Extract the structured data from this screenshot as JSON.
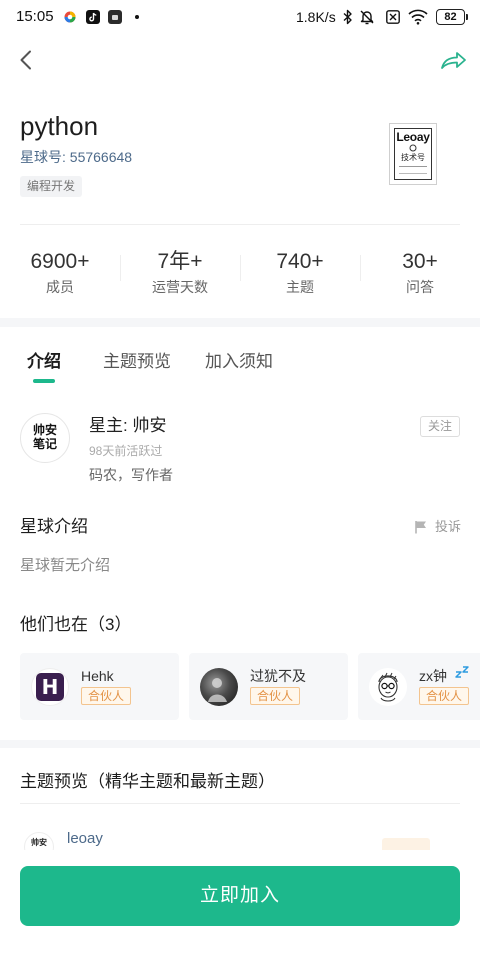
{
  "status_bar": {
    "time": "15:05",
    "net_speed": "1.8K/s",
    "battery": "82",
    "left_icons": [
      "app-color-icon",
      "tiktok-icon",
      "app-icon",
      "notification-dot-icon"
    ],
    "right_icons": [
      "bluetooth-icon",
      "mute-icon",
      "sim-off-icon",
      "wifi-icon",
      "battery-icon"
    ]
  },
  "nav": {
    "back_icon": "chevron-left-icon",
    "share_icon": "share-icon"
  },
  "planet": {
    "name": "python",
    "id_label": "星球号: 55766648",
    "category_tag": "编程开发",
    "logo": {
      "title": "Leoay",
      "subtitle": "技术号"
    }
  },
  "stats": [
    {
      "value": "6900+",
      "label": "成员"
    },
    {
      "value": "7年+",
      "label": "运营天数"
    },
    {
      "value": "740+",
      "label": "主题"
    },
    {
      "value": "30+",
      "label": "问答"
    }
  ],
  "tabs": [
    {
      "label": "介绍",
      "active": true
    },
    {
      "label": "主题预览",
      "active": false
    },
    {
      "label": "加入须知",
      "active": false
    }
  ],
  "owner": {
    "avatar_lines": [
      "帅安",
      "笔记"
    ],
    "title": "星主: 帅安",
    "last_active": "98天前活跃过",
    "bio": "码农，写作者",
    "follow_label": "关注"
  },
  "intro": {
    "heading": "星球介绍",
    "report_icon": "flag-icon",
    "report_label": "投诉",
    "text": "星球暂无介绍"
  },
  "also_in": {
    "heading": "他们也在（3）",
    "members": [
      {
        "name": "Hehk",
        "role": "合伙人",
        "avatar_mark": "H"
      },
      {
        "name": "过犹不及",
        "role": "合伙人"
      },
      {
        "name": "zx钟",
        "role": "合伙人",
        "status_icon": "sleep-icon"
      }
    ]
  },
  "preview": {
    "heading": "主题预览（精华主题和最新主题）",
    "first_item": {
      "author": "leoay"
    }
  },
  "cta": {
    "label": "立即加入"
  },
  "colors": {
    "accent": "#1db88c",
    "id_text": "#4d6a8a",
    "partner_tag": "#e39347",
    "section_gap": "#f5f6f8"
  }
}
